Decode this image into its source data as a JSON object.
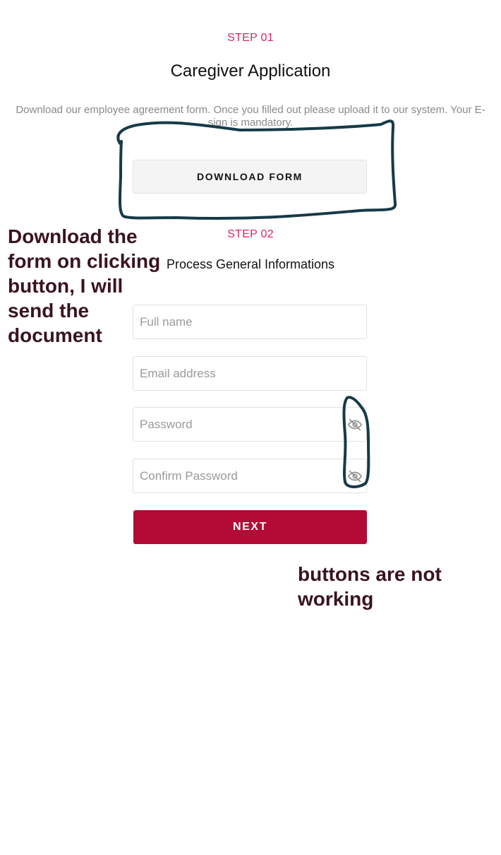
{
  "step1": {
    "label": "STEP 01",
    "title": "Caregiver Application",
    "description": "Download our employee agreement form. Once you filled out please upload it to our system. Your E-sign is mandatory.",
    "download_button": "DOWNLOAD FORM"
  },
  "step2": {
    "label": "STEP 02",
    "title": "Process General Informations",
    "fields": {
      "full_name": {
        "placeholder": "Full name",
        "value": ""
      },
      "email": {
        "placeholder": "Email address",
        "value": ""
      },
      "password": {
        "placeholder": "Password",
        "value": ""
      },
      "confirm_password": {
        "placeholder": "Confirm Password",
        "value": ""
      }
    },
    "next_button": "NEXT"
  },
  "annotations": {
    "download_note": "Download the form on clicking button, I will send the document",
    "buttons_note": "buttons are not working"
  },
  "icons": {
    "password_toggle": "eye-off-icon",
    "confirm_password_toggle": "eye-off-icon"
  },
  "colors": {
    "step_label": "#e0245e",
    "primary_button": "#b30b35",
    "annotation_text": "#3a1220",
    "markup_stroke": "#163a48"
  }
}
